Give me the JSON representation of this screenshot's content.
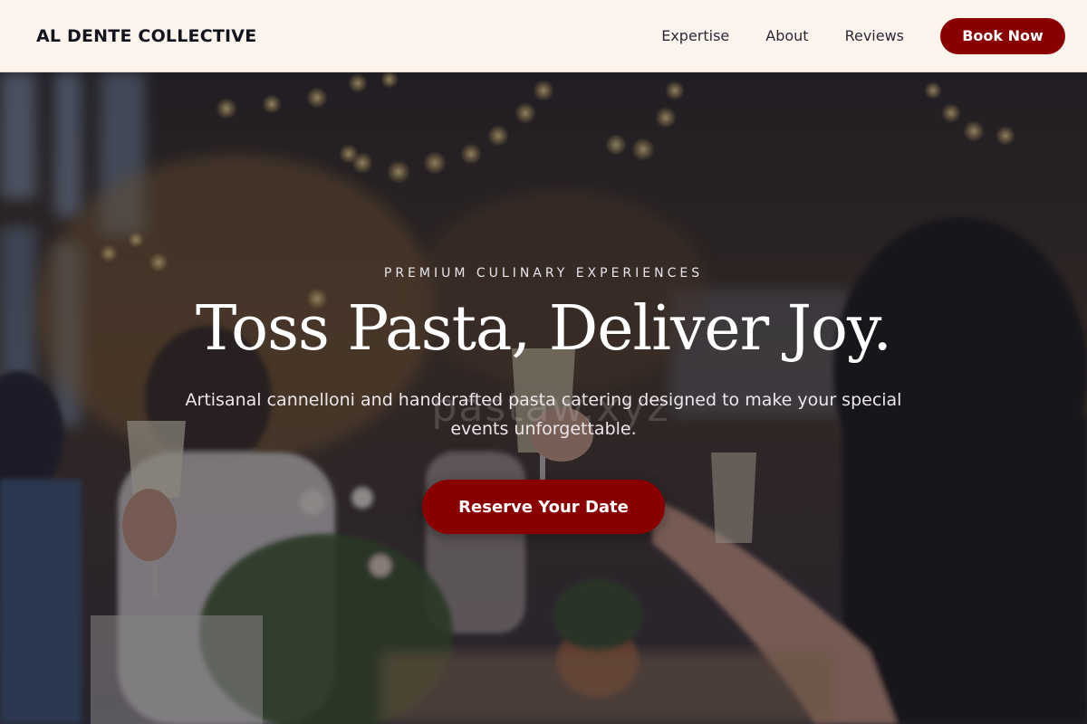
{
  "header": {
    "brand": "AL DENTE COLLECTIVE",
    "nav": [
      "Expertise",
      "About",
      "Reviews"
    ],
    "cta_label": "Book Now"
  },
  "hero": {
    "eyebrow": "PREMIUM CULINARY EXPERIENCES",
    "headline": "Toss Pasta, Deliver Joy.",
    "subtitle": "Artisanal cannelloni and handcrafted pasta catering designed to make your special events unforgettable.",
    "watermark": "pastaw.xyz",
    "cta_label": "Reserve Your Date",
    "background_image": "dinner-party-toast-photo"
  },
  "colors": {
    "header_bg": "#fdf4ee",
    "accent": "#8a0000",
    "text_dark": "#14141f"
  }
}
